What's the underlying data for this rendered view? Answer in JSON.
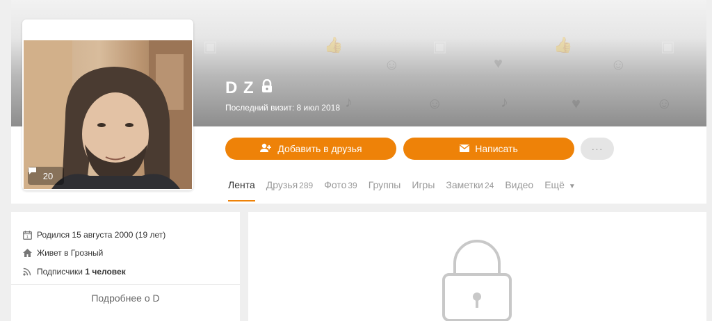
{
  "profile": {
    "name": "D Z",
    "last_visit": "Последний визит: 8 июл 2018",
    "comments_count": "20"
  },
  "actions": {
    "add_friend": "Добавить в друзья",
    "write": "Написать",
    "more": "···"
  },
  "tabs": [
    {
      "label": "Лента",
      "count": ""
    },
    {
      "label": "Друзья",
      "count": "289"
    },
    {
      "label": "Фото",
      "count": "39"
    },
    {
      "label": "Группы",
      "count": ""
    },
    {
      "label": "Игры",
      "count": ""
    },
    {
      "label": "Заметки",
      "count": "24"
    },
    {
      "label": "Видео",
      "count": ""
    },
    {
      "label": "Ещё",
      "count": ""
    }
  ],
  "info": {
    "born": "Родился 15 августа 2000 (19 лет)",
    "lives": "Живет в Грозный",
    "followers_prefix": "Подписчики ",
    "followers_value": "1 человек",
    "more_link": "Подробнее о D"
  },
  "colors": {
    "accent": "#ee8208",
    "background": "#efefef",
    "card": "#ffffff"
  }
}
